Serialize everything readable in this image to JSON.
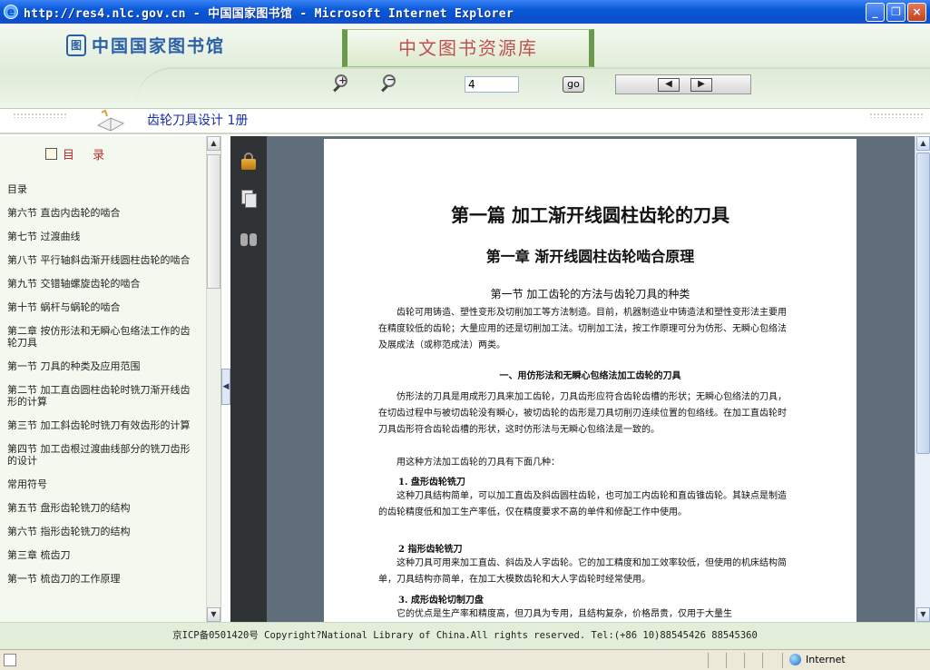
{
  "window": {
    "title": "http://res4.nlc.gov.cn - 中国国家图书馆 - Microsoft Internet Explorer",
    "minimize": "_",
    "restore": "❐",
    "close": "×"
  },
  "header": {
    "logo_text": "中国国家图书馆",
    "banner": "中文图书资源库",
    "page_input_value": "4",
    "go_label": "go",
    "prev_label": "◀",
    "next_label": "▶"
  },
  "book": {
    "title": "齿轮刀具设计 1册"
  },
  "toc": {
    "heading": "目 录",
    "items": [
      "目录",
      "第六节 直齿内齿轮的啮合",
      "第七节 过渡曲线",
      "第八节 平行轴斜齿渐开线圆柱齿轮的啮合",
      "第九节 交错轴螺旋齿轮的啮合",
      "第十节 蜗杆与蜗轮的啮合",
      "第二章 按仿形法和无瞬心包络法工作的齿轮刀具",
      "第一节 刀具的种类及应用范围",
      "第二节 加工直齿圆柱齿轮时铣刀渐开线齿形的计算",
      "第三节 加工斜齿轮时铣刀有效齿形的计算",
      "第四节 加工齿根过渡曲线部分的铣刀齿形的设计",
      "常用符号",
      "第五节 盘形齿轮铣刀的结构",
      "第六节 指形齿轮铣刀的结构",
      "第三章 梳齿刀",
      "第一节 梳齿刀的工作原理"
    ]
  },
  "document": {
    "part_title": "第一篇  加工渐开线圆柱齿轮的刀具",
    "chapter_title": "第一章  渐开线圆柱齿轮啮合原理",
    "section_title": "第一节  加工齿轮的方法与齿轮刀具的种类",
    "para1": "齿轮可用铸造、塑性变形及切削加工等方法制造。目前，机器制造业中铸造法和塑性变形法主要用在精度较低的齿轮；大量应用的还是切削加工法。切削加工法，按工作原理可分为仿形、无瞬心包络法及展成法（或称范成法）两类。",
    "subhead1": "一、用仿形法和无瞬心包络法加工齿轮的刀具",
    "para2": "仿形法的刀具是用成形刀具来加工齿轮，刀具齿形应符合齿轮齿槽的形状；无瞬心包络法的刀具，在切齿过程中与被切齿轮没有瞬心，被切齿轮的齿形是刀具切削刃连续位置的包络线。在加工直齿轮时刀具齿形符合齿轮齿槽的形状，这时仿形法与无瞬心包络法是一致的。",
    "para3": "用这种方法加工齿轮的刀具有下面几种：",
    "item1": "1. 盘形齿轮铣刀",
    "para4": "这种刀具结构简单，可以加工直齿及斜齿圆柱齿轮，也可加工内齿轮和直齿锥齿轮。其缺点是制造的齿轮精度低和加工生产率低，仅在精度要求不高的单件和修配工作中使用。",
    "item2": "2  指形齿轮铣刀",
    "para5": "这种刀具可用来加工直齿、斜齿及人字齿轮。它的加工精度和加工效率较低，但使用的机床结构简单，刀具结构亦简单，在加工大模数齿轮和大人字齿轮时经常使用。",
    "item3": "3. 成形齿轮切制刀盘",
    "para6": "它的优点是生产率和精度高，但刀具为专用，且结构复杂，价格昂贵，仅用于大量生"
  },
  "footer": {
    "text": "京ICP备0501420号 Copyright?National Library of China.All rights reserved. Tel:(+86 10)88545426 88545360"
  },
  "status": {
    "zone": "Internet"
  }
}
